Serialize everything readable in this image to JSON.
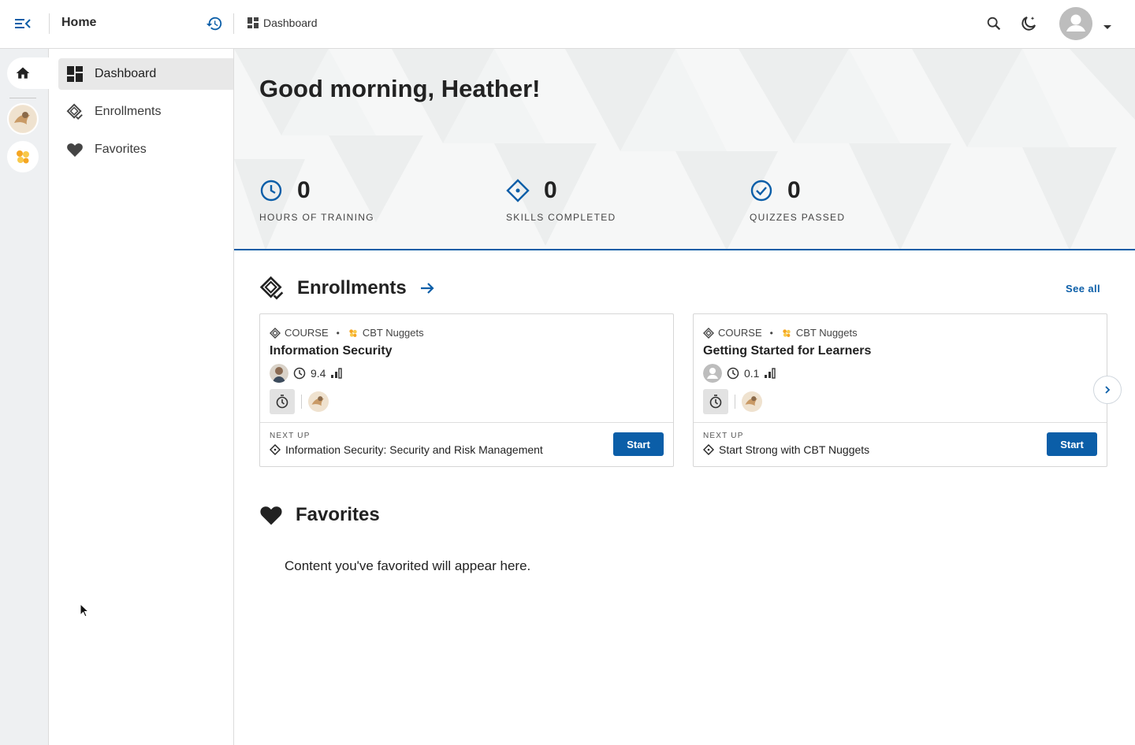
{
  "topbar": {
    "home_title": "Home",
    "breadcrumb": "Dashboard"
  },
  "sidenav": {
    "items": [
      {
        "label": "Dashboard",
        "icon": "dashboard-icon",
        "active": true
      },
      {
        "label": "Enrollments",
        "icon": "enrollments-icon",
        "active": false
      },
      {
        "label": "Favorites",
        "icon": "heart-icon",
        "active": false
      }
    ]
  },
  "hero": {
    "greeting": "Good morning, Heather!",
    "stats": [
      {
        "value": "0",
        "label": "HOURS OF TRAINING",
        "icon": "clock-icon"
      },
      {
        "value": "0",
        "label": "SKILLS COMPLETED",
        "icon": "diamond-icon"
      },
      {
        "value": "0",
        "label": "QUIZZES PASSED",
        "icon": "check-circle-icon"
      }
    ]
  },
  "enrollments": {
    "title": "Enrollments",
    "see_all": "See all",
    "cards": [
      {
        "type": "COURSE",
        "provider": "CBT Nuggets",
        "title": "Information Security",
        "hours": "9.4",
        "next_up_label": "NEXT UP",
        "next_up": "Information Security: Security and Risk Management",
        "button": "Start"
      },
      {
        "type": "COURSE",
        "provider": "CBT Nuggets",
        "title": "Getting Started for Learners",
        "hours": "0.1",
        "next_up_label": "NEXT UP",
        "next_up": "Start Strong with CBT Nuggets",
        "button": "Start"
      }
    ]
  },
  "favorites": {
    "title": "Favorites",
    "empty": "Content you've favorited will appear here."
  },
  "colors": {
    "accent": "#0b5ea8",
    "hero_border": "#0d5ea6"
  }
}
